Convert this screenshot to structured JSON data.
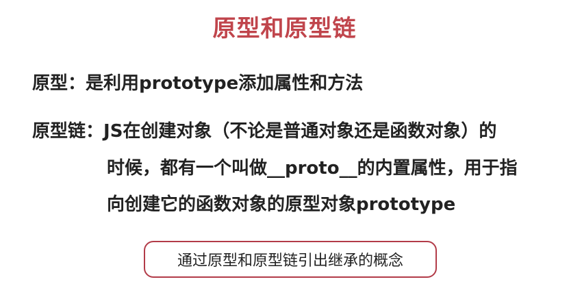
{
  "slide": {
    "title": "原型和原型链",
    "definitions": [
      {
        "label": "原型：",
        "text": "是利用prototype添加属性和方法"
      },
      {
        "label": "原型链：",
        "lines": [
          "JS在创建对象（不论是普通对象还是函数对象）的",
          "时候，都有一个叫做__proto__的内置属性，用于指",
          "向创建它的函数对象的原型对象prototype"
        ]
      }
    ],
    "callout": "通过原型和原型链引出继承的概念"
  },
  "colors": {
    "title": "#c0454c",
    "callout_border": "#b23b48",
    "text": "#222222"
  }
}
